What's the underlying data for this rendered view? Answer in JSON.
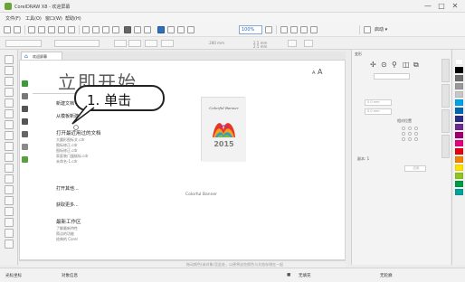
{
  "window": {
    "title": "CorelDRAW X8 - 欢迎屏幕",
    "controls": [
      "—",
      "□",
      "✕"
    ]
  },
  "menubar": {
    "items": [
      "文件(F)",
      "工具(O)",
      "窗口(W)",
      "帮助(H)"
    ]
  },
  "toolbar": {
    "zoom": "100%",
    "launch": "启动 ▾"
  },
  "propbar": {
    "width": "216 mm",
    "height": "279 mm",
    "unit_w": "2.5 mm",
    "unit_h": "2.5 mm",
    "x": ".280 mm"
  },
  "tab": {
    "label": "欢迎屏幕"
  },
  "welcome": {
    "title": "立即开始",
    "font_size_control": {
      "small": "A",
      "large": "A"
    },
    "callout": "1. 单击",
    "links": [
      {
        "id": "new-doc",
        "label": "新建文档"
      },
      {
        "id": "from-template",
        "label": "从模板新建"
      },
      {
        "id": "open-recent",
        "label": "打开最近用过的文档"
      },
      {
        "id": "open-other",
        "label": "打开其他..."
      },
      {
        "id": "get-more",
        "label": "获取更多..."
      },
      {
        "id": "workspace",
        "label": "最新工作区"
      }
    ],
    "recent_files": [
      "大圆形图标文.cdr",
      "图标修正.cdr",
      "图标修正.cdr",
      "家庭装门蛋糕标.cdr",
      "未命名-1.cdr"
    ],
    "workspace_items": [
      "了解最新特性",
      "简洁的功能",
      "经典的 Corel"
    ],
    "cover": {
      "label": "Colorful Banner",
      "year": "2015"
    },
    "caption": "Colorful Banner"
  },
  "docker": {
    "title": "变形",
    "icons": [
      "✢",
      "⊙",
      "⚲",
      "◫",
      "⧉"
    ],
    "field_x": "0.0 mm",
    "field_y": "0.0 mm",
    "label_position": "相对位置",
    "label_copies": "副本: 1",
    "apply": "应用"
  },
  "palette": {
    "colors": [
      "#ffffff",
      "#000000",
      "#6e6e6e",
      "#999999",
      "#c7c7c7",
      "#00a3e8",
      "#0066b3",
      "#2c2e83",
      "#6b2e8c",
      "#a0006e",
      "#e4007f",
      "#e60012",
      "#f08300",
      "#ffe100",
      "#8fc31f",
      "#009944",
      "#00a29a"
    ]
  },
  "pagebar": {
    "hint": "拖动颜色(或对象)至此处，以便将这些颜色与文档存储在一起"
  },
  "status": {
    "coords": "光标坐标",
    "info": "对象信息",
    "fill": "无填充",
    "outline": "无轮廓"
  }
}
